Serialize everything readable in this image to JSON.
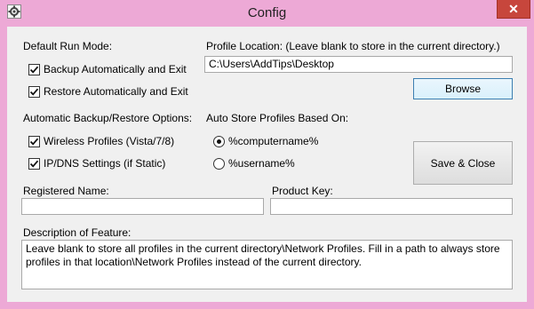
{
  "window": {
    "title": "Config",
    "close_glyph": "✕"
  },
  "run_mode": {
    "heading": "Default Run Mode:",
    "backup_label": "Backup Automatically and Exit",
    "backup_checked": true,
    "restore_label": "Restore Automatically and Exit",
    "restore_checked": true
  },
  "profile_location": {
    "heading": "Profile Location:  (Leave blank to store in the current directory.)",
    "value": "C:\\Users\\AddTips\\Desktop",
    "browse_label": "Browse"
  },
  "options": {
    "heading": "Automatic Backup/Restore Options:",
    "wireless_label": "Wireless Profiles (Vista/7/8)",
    "wireless_checked": true,
    "ipdns_label": "IP/DNS Settings (if Static)",
    "ipdns_checked": true
  },
  "auto_store": {
    "heading": "Auto Store Profiles Based On:",
    "computername_label": "%computername%",
    "username_label": "%username%",
    "selected": "computername"
  },
  "save_close_label": "Save & Close",
  "registered_name": {
    "label": "Registered Name:",
    "value": ""
  },
  "product_key": {
    "label": "Product Key:",
    "value": ""
  },
  "description": {
    "label": "Description of Feature:",
    "text": "Leave blank to store all profiles in the current directory\\Network Profiles.  Fill in a path to always store profiles in that location\\Network Profiles instead of the current directory."
  },
  "colors": {
    "frame": "#eda9d6",
    "close": "#c7463c",
    "client": "#f0f0f0"
  }
}
